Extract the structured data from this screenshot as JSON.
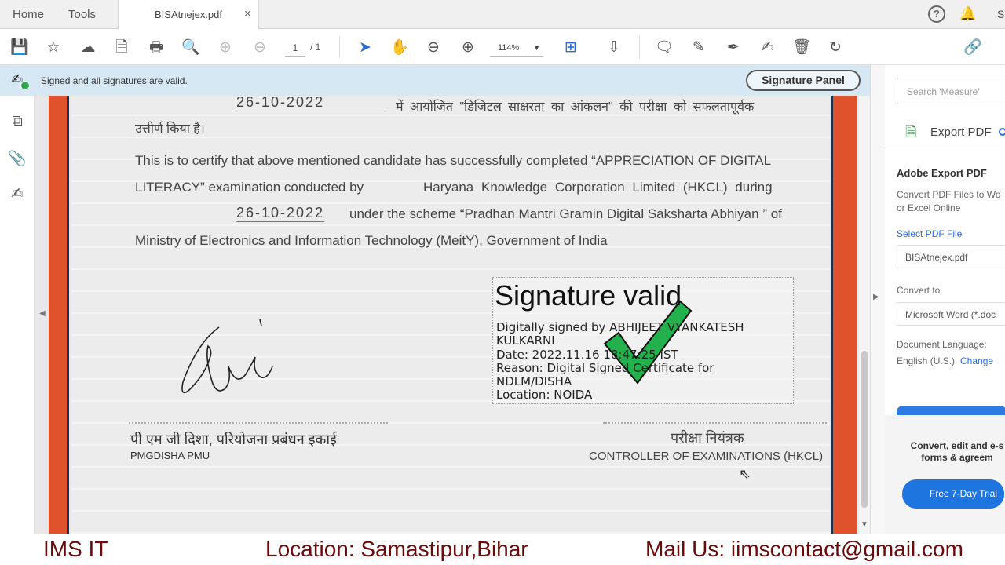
{
  "tabs": {
    "home": "Home",
    "tools": "Tools",
    "document": "BISAtnejex.pdf",
    "close": "×",
    "user_initial": "S"
  },
  "toolbar": {
    "page_current": "1",
    "page_total": "/ 1",
    "zoom": "114%",
    "icons": [
      "save-icon",
      "star-icon",
      "upload-icon",
      "file-lock-icon",
      "print-icon",
      "search-icon",
      "page-up-icon",
      "page-down-icon",
      "select-icon",
      "hand-icon",
      "zoom-out-icon",
      "zoom-in-icon",
      "page-layout-icon",
      "scroll-icon",
      "comment-icon",
      "highlight-icon",
      "sign-icon",
      "fill-sign-icon",
      "delete-icon",
      "rotate-icon",
      "link-icon"
    ]
  },
  "signature_bar": {
    "message": "Signed and all signatures are valid.",
    "panel_button": "Signature Panel"
  },
  "document": {
    "date_top": "26-10-2022",
    "hindi_line1": "में आयोजित \"डिजिटल साक्षरता का आंकलन\" की परीक्षा को सफलतापूर्वक",
    "hindi_line2": "उत्तीर्ण किया है।",
    "english_line1": "This is to certify that above mentioned candidate has successfully completed “APPRECIATION OF DIGITAL",
    "english_line2a": "LITERACY”  examination  conducted  by",
    "english_line2b": "Haryana Knowledge Corporation Limited (HKCL) during",
    "date_mid": "26-10-2022",
    "english_line3": "under the scheme “Pradhan Mantri Gramin Digital Saksharta Abhiyan ” of",
    "english_line4": "Ministry of Electronics and Information Technology (MeitY), Government of India",
    "signature_stamp": {
      "title": "Signature valid",
      "signed_by": "Digitally signed by ABHIJEET VYANKATESH",
      "signed_by_2": "KULKARNI",
      "date": "Date: 2022.11.16 18:47:25 IST",
      "reason": "Reason: Digital Signed Certificate for",
      "reason_2": "NDLM/DISHA",
      "location": "Location: NOIDA"
    },
    "left_hindi": "पी एम जी दिशा, परियोजना प्रबंधन इकाई",
    "left_label": "PMGDISHA PMU",
    "right_hindi": "परीक्षा नियंत्रक",
    "right_label": "CONTROLLER OF EXAMINATIONS (HKCL)"
  },
  "right_panel": {
    "search_placeholder": "Search 'Measure'",
    "export_label": "Export PDF",
    "heading": "Adobe Export PDF",
    "desc1": "Convert PDF Files to Wo",
    "desc2": "or Excel Online",
    "select_label": "Select PDF File",
    "file_name": "BISAtnejex.pdf",
    "convert_label": "Convert to",
    "convert_value": "Microsoft Word (*.doc",
    "lang_label": "Document Language:",
    "lang_value": "English (U.S.)",
    "lang_change": "Change",
    "promo1": "Convert, edit and e-s",
    "promo2": "forms & agreem",
    "trial_button": "Free 7-Day Trial"
  },
  "footer": {
    "left": "IMS IT",
    "middle": "Location: Samastipur,Bihar",
    "right": "Mail Us: iimscontact@gmail.com"
  },
  "colors": {
    "accent": "#2d6bd2",
    "signature_bar": "#d7e8f5",
    "certificate_border": "#e0522c",
    "check_green": "#22b14c",
    "footer_text": "#6b0a0a"
  }
}
